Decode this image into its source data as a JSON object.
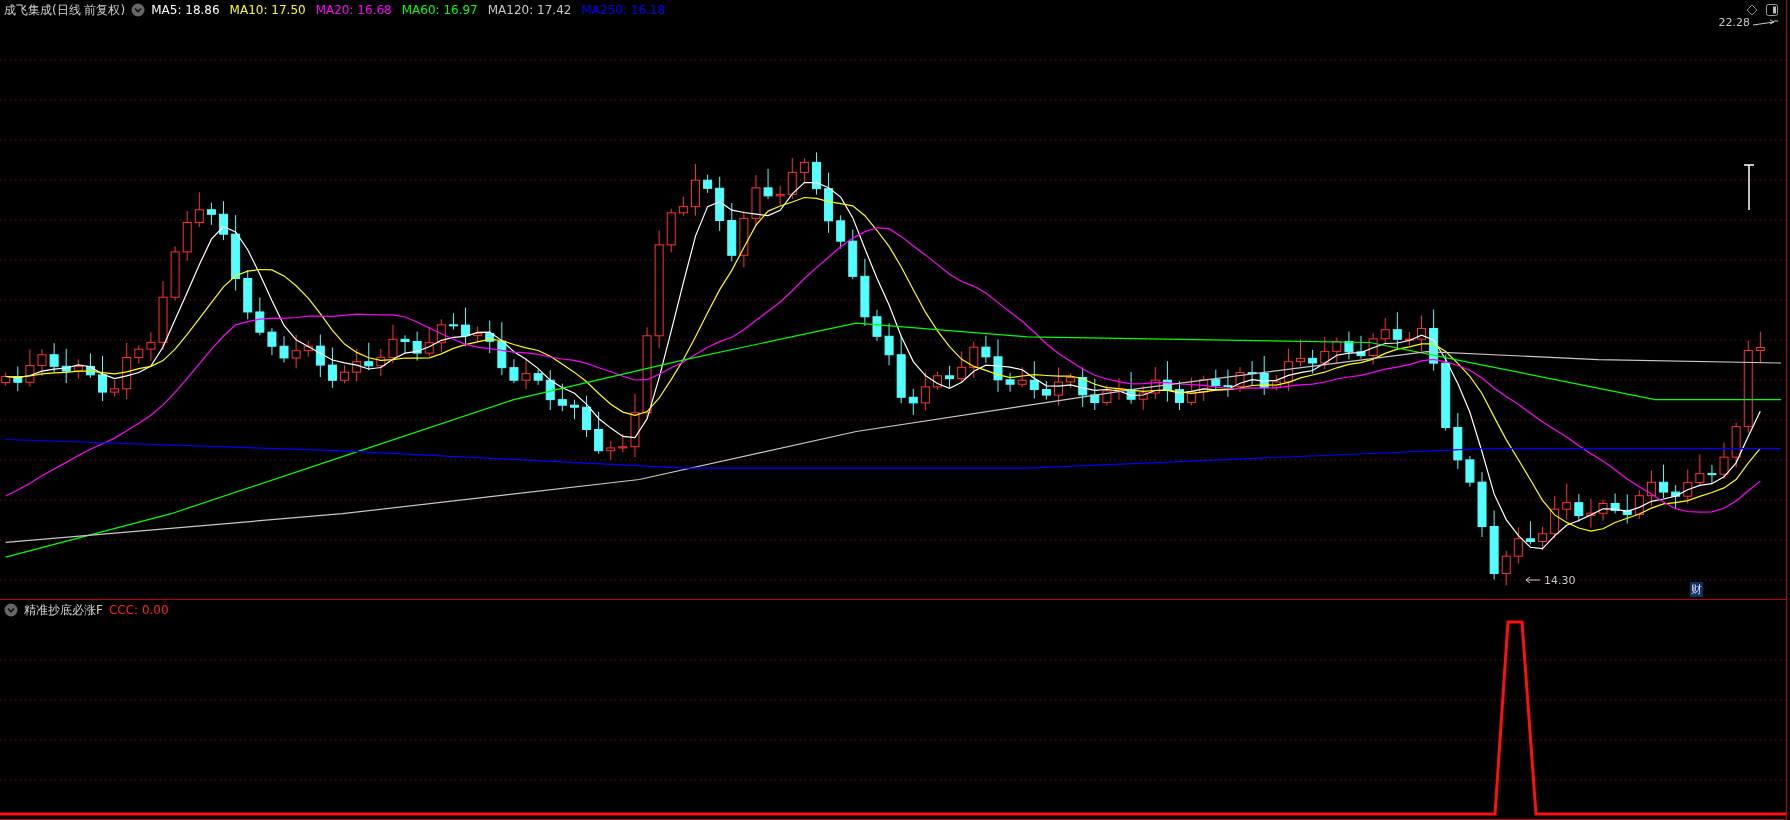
{
  "main_pane": {
    "title": "成飞集成(日线 前复权)",
    "moving_averages": [
      {
        "label": "MA5: 18.86",
        "color": "#ffffff"
      },
      {
        "label": "MA10: 17.50",
        "color": "#ffff00"
      },
      {
        "label": "MA20: 16.68",
        "color": "#ff00ff"
      },
      {
        "label": "MA60: 16.97",
        "color": "#00ff00"
      },
      {
        "label": "MA120: 17.42",
        "color": "#c8c8c8"
      },
      {
        "label": "MA250: 16.18",
        "color": "#0000ff"
      }
    ],
    "high_label": "22.28",
    "low_label": "14.30",
    "badge": "财"
  },
  "indicator_pane": {
    "title": "精准抄底必涨F",
    "reading": "CCC: 0.00"
  }
}
